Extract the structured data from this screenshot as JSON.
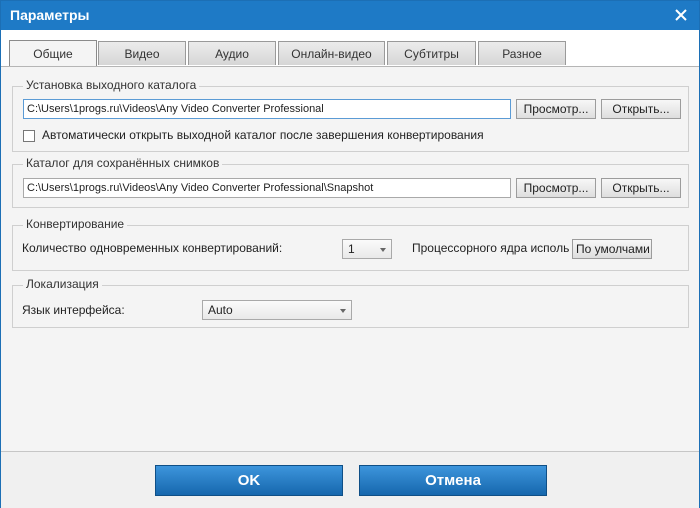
{
  "window": {
    "title": "Параметры"
  },
  "tabs": [
    {
      "label": "Общие",
      "active": true
    },
    {
      "label": "Видео"
    },
    {
      "label": "Аудио"
    },
    {
      "label": "Онлайн-видео"
    },
    {
      "label": "Субтитры"
    },
    {
      "label": "Разное"
    }
  ],
  "output_dir": {
    "group_label": "Установка выходного каталога",
    "path": "C:\\Users\\1progs.ru\\Videos\\Any Video Converter Professional",
    "browse_label": "Просмотр...",
    "open_label": "Открыть...",
    "auto_open_label": "Автоматически открыть выходной каталог после завершения конвертирования",
    "auto_open_checked": false
  },
  "snapshot_dir": {
    "group_label": "Каталог для сохранённых снимков",
    "path": "C:\\Users\\1progs.ru\\Videos\\Any Video Converter Professional\\Snapshot",
    "browse_label": "Просмотр...",
    "open_label": "Открыть..."
  },
  "conversion": {
    "group_label": "Конвертирование",
    "simultaneous_label": "Количество одновременных конвертирований:",
    "simultaneous_value": "1",
    "cpu_cores_label": "Процессорного ядра исполь",
    "cpu_cores_value": "По умолчами"
  },
  "localization": {
    "group_label": "Локализация",
    "language_label": "Язык интерфейса:",
    "language_value": "Auto"
  },
  "footer": {
    "ok_label": "OK",
    "cancel_label": "Отмена"
  },
  "colors": {
    "titlebar": "#1e7ac6",
    "primary_button": "#1667ad"
  }
}
